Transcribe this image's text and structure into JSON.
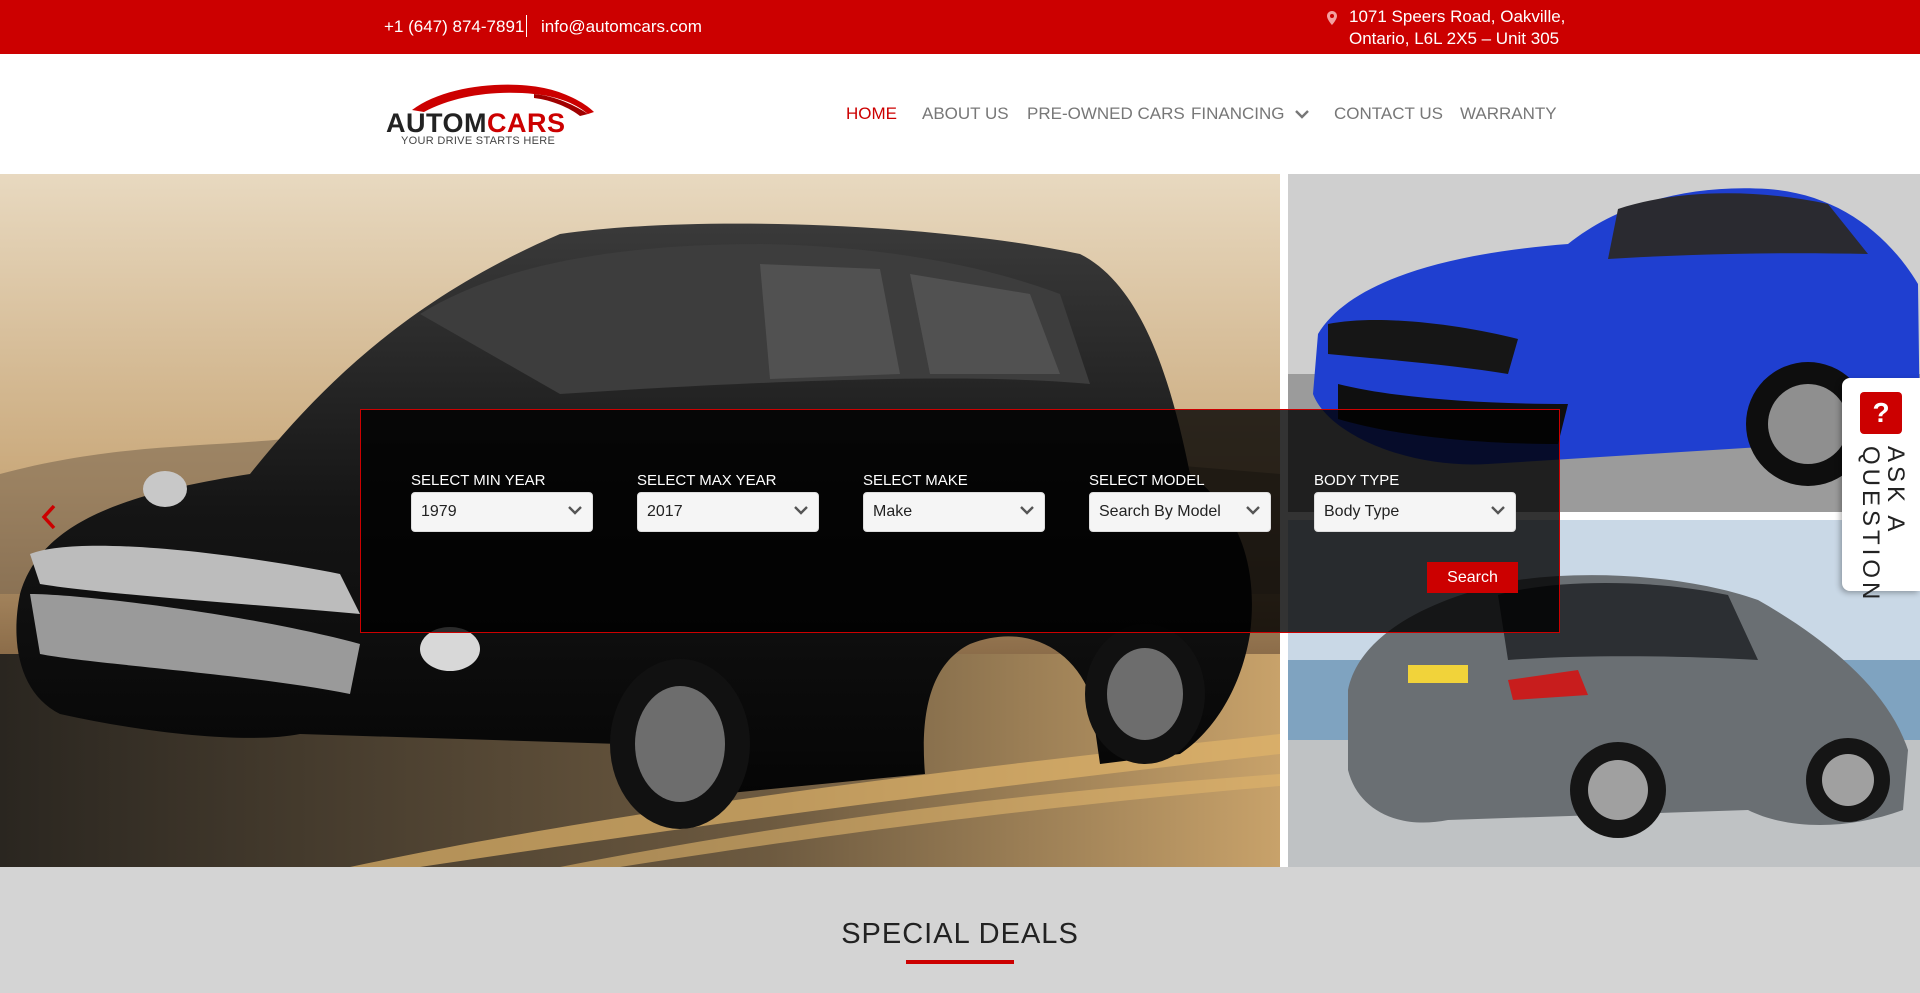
{
  "topbar": {
    "phone": "+1 (647) 874-7891",
    "email": "info@automcars.com",
    "address_line1": "1071 Speers Road, Oakville,",
    "address_line2": "Ontario, L6L 2X5 – Unit 305",
    "icon": "map-pin-icon"
  },
  "logo": {
    "text_dark": "AUTOM",
    "text_red": "CARS",
    "tagline": "YOUR DRIVE STARTS HERE"
  },
  "nav": {
    "items": [
      {
        "label": "HOME",
        "active": true
      },
      {
        "label": "ABOUT US"
      },
      {
        "label": "PRE-OWNED CARS"
      },
      {
        "label": "FINANCING",
        "has_dropdown": true
      },
      {
        "label": "CONTACT US"
      },
      {
        "label": "WARRANTY"
      }
    ]
  },
  "search": {
    "fields": [
      {
        "label": "SELECT MIN YEAR",
        "value": "1979"
      },
      {
        "label": "SELECT MAX YEAR",
        "value": "2017"
      },
      {
        "label": "SELECT MAKE",
        "value": "Make"
      },
      {
        "label": "SELECT MODEL",
        "value": "Search By Model"
      },
      {
        "label": "BODY TYPE",
        "value": "Body Type"
      }
    ],
    "button_label": "Search"
  },
  "ask": {
    "icon_glyph": "?",
    "label": "ASK A\nQUESTION"
  },
  "deals": {
    "title": "SPECIAL DEALS"
  },
  "colors": {
    "brand_red": "#cc0000",
    "nav_gray": "#777777",
    "section_bg": "#d4d4d4"
  }
}
